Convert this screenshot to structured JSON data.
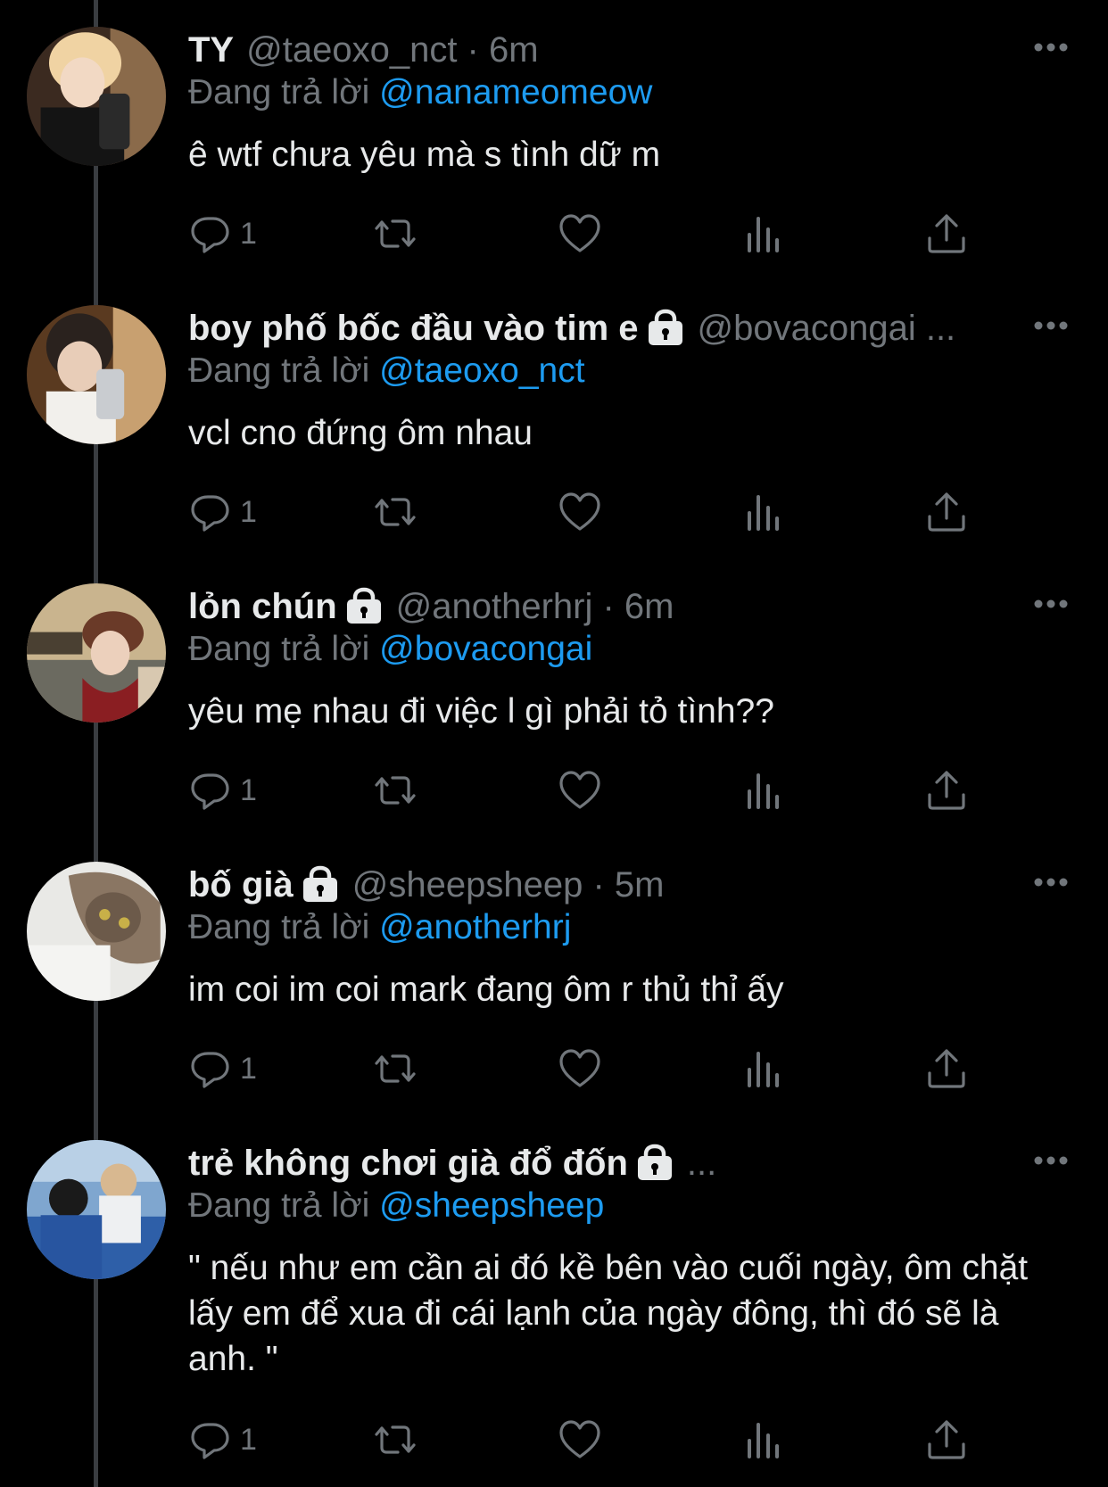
{
  "colors": {
    "background": "#000000",
    "text": "#e7e9ea",
    "secondary": "#71767b",
    "mention": "#1d9bf0",
    "thread_line": "#3a3d41"
  },
  "tweets": [
    {
      "display_name": "TY",
      "locked": false,
      "meta": "@taeoxo_nct · 6m",
      "reply_prefix": "Đang trả lời",
      "reply_to": "@nanameomeow",
      "text": "ê wtf chưa yêu mà s tình dữ m",
      "reply_count": "1"
    },
    {
      "display_name": "boy phố bốc đầu vào tim e",
      "locked": true,
      "meta": "@bovacongai ...",
      "reply_prefix": "Đang trả lời",
      "reply_to": "@taeoxo_nct",
      "text": "vcl cno đứng ôm nhau",
      "reply_count": "1"
    },
    {
      "display_name": "lỏn chún",
      "locked": true,
      "meta": "@anotherhrj · 6m",
      "reply_prefix": "Đang trả lời",
      "reply_to": "@bovacongai",
      "text": "yêu mẹ nhau đi việc l gì phải tỏ tình??",
      "reply_count": "1"
    },
    {
      "display_name": "bố già",
      "locked": true,
      "meta": "@sheepsheep · 5m",
      "reply_prefix": "Đang trả lời",
      "reply_to": "@anotherhrj",
      "text": "im coi im coi mark đang ôm r thủ thỉ ấy",
      "reply_count": "1"
    },
    {
      "display_name": "trẻ không chơi già đổ đốn",
      "locked": true,
      "meta": "...",
      "reply_prefix": "Đang trả lời",
      "reply_to": "@sheepsheep",
      "text": "\" nếu như em cần ai đó kề bên vào cuối ngày, ôm chặt lấy em để xua đi cái lạnh của ngày đông, thì đó sẽ là anh. \"",
      "reply_count": "1"
    }
  ],
  "icons": {
    "more": "more-dots-icon",
    "lock": "lock-icon",
    "reply": "reply-bubble-icon",
    "retweet": "retweet-icon",
    "like": "heart-icon",
    "views": "views-bar-chart-icon",
    "share": "share-upload-icon"
  }
}
